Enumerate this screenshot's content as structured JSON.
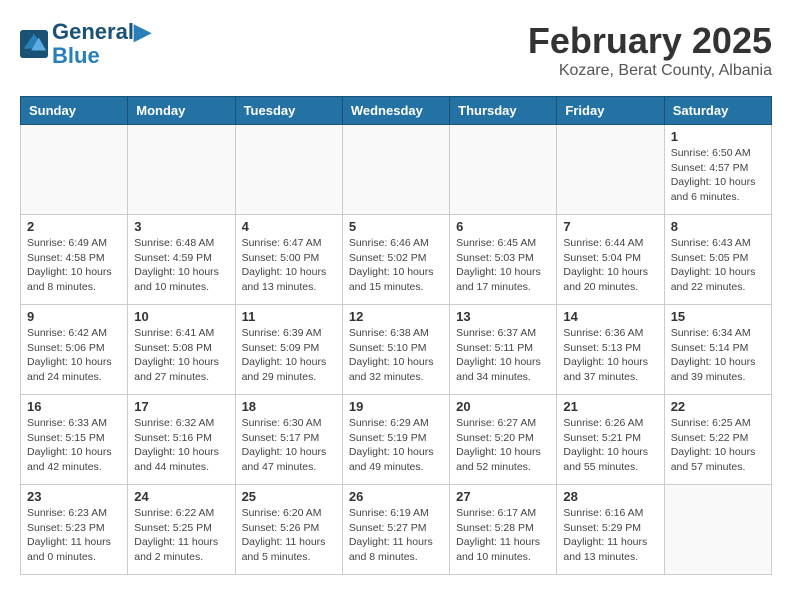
{
  "header": {
    "logo_line1": "General",
    "logo_line2": "Blue",
    "title": "February 2025",
    "subtitle": "Kozare, Berat County, Albania"
  },
  "weekdays": [
    "Sunday",
    "Monday",
    "Tuesday",
    "Wednesday",
    "Thursday",
    "Friday",
    "Saturday"
  ],
  "weeks": [
    [
      {
        "day": "",
        "info": ""
      },
      {
        "day": "",
        "info": ""
      },
      {
        "day": "",
        "info": ""
      },
      {
        "day": "",
        "info": ""
      },
      {
        "day": "",
        "info": ""
      },
      {
        "day": "",
        "info": ""
      },
      {
        "day": "1",
        "info": "Sunrise: 6:50 AM\nSunset: 4:57 PM\nDaylight: 10 hours\nand 6 minutes."
      }
    ],
    [
      {
        "day": "2",
        "info": "Sunrise: 6:49 AM\nSunset: 4:58 PM\nDaylight: 10 hours\nand 8 minutes."
      },
      {
        "day": "3",
        "info": "Sunrise: 6:48 AM\nSunset: 4:59 PM\nDaylight: 10 hours\nand 10 minutes."
      },
      {
        "day": "4",
        "info": "Sunrise: 6:47 AM\nSunset: 5:00 PM\nDaylight: 10 hours\nand 13 minutes."
      },
      {
        "day": "5",
        "info": "Sunrise: 6:46 AM\nSunset: 5:02 PM\nDaylight: 10 hours\nand 15 minutes."
      },
      {
        "day": "6",
        "info": "Sunrise: 6:45 AM\nSunset: 5:03 PM\nDaylight: 10 hours\nand 17 minutes."
      },
      {
        "day": "7",
        "info": "Sunrise: 6:44 AM\nSunset: 5:04 PM\nDaylight: 10 hours\nand 20 minutes."
      },
      {
        "day": "8",
        "info": "Sunrise: 6:43 AM\nSunset: 5:05 PM\nDaylight: 10 hours\nand 22 minutes."
      }
    ],
    [
      {
        "day": "9",
        "info": "Sunrise: 6:42 AM\nSunset: 5:06 PM\nDaylight: 10 hours\nand 24 minutes."
      },
      {
        "day": "10",
        "info": "Sunrise: 6:41 AM\nSunset: 5:08 PM\nDaylight: 10 hours\nand 27 minutes."
      },
      {
        "day": "11",
        "info": "Sunrise: 6:39 AM\nSunset: 5:09 PM\nDaylight: 10 hours\nand 29 minutes."
      },
      {
        "day": "12",
        "info": "Sunrise: 6:38 AM\nSunset: 5:10 PM\nDaylight: 10 hours\nand 32 minutes."
      },
      {
        "day": "13",
        "info": "Sunrise: 6:37 AM\nSunset: 5:11 PM\nDaylight: 10 hours\nand 34 minutes."
      },
      {
        "day": "14",
        "info": "Sunrise: 6:36 AM\nSunset: 5:13 PM\nDaylight: 10 hours\nand 37 minutes."
      },
      {
        "day": "15",
        "info": "Sunrise: 6:34 AM\nSunset: 5:14 PM\nDaylight: 10 hours\nand 39 minutes."
      }
    ],
    [
      {
        "day": "16",
        "info": "Sunrise: 6:33 AM\nSunset: 5:15 PM\nDaylight: 10 hours\nand 42 minutes."
      },
      {
        "day": "17",
        "info": "Sunrise: 6:32 AM\nSunset: 5:16 PM\nDaylight: 10 hours\nand 44 minutes."
      },
      {
        "day": "18",
        "info": "Sunrise: 6:30 AM\nSunset: 5:17 PM\nDaylight: 10 hours\nand 47 minutes."
      },
      {
        "day": "19",
        "info": "Sunrise: 6:29 AM\nSunset: 5:19 PM\nDaylight: 10 hours\nand 49 minutes."
      },
      {
        "day": "20",
        "info": "Sunrise: 6:27 AM\nSunset: 5:20 PM\nDaylight: 10 hours\nand 52 minutes."
      },
      {
        "day": "21",
        "info": "Sunrise: 6:26 AM\nSunset: 5:21 PM\nDaylight: 10 hours\nand 55 minutes."
      },
      {
        "day": "22",
        "info": "Sunrise: 6:25 AM\nSunset: 5:22 PM\nDaylight: 10 hours\nand 57 minutes."
      }
    ],
    [
      {
        "day": "23",
        "info": "Sunrise: 6:23 AM\nSunset: 5:23 PM\nDaylight: 11 hours\nand 0 minutes."
      },
      {
        "day": "24",
        "info": "Sunrise: 6:22 AM\nSunset: 5:25 PM\nDaylight: 11 hours\nand 2 minutes."
      },
      {
        "day": "25",
        "info": "Sunrise: 6:20 AM\nSunset: 5:26 PM\nDaylight: 11 hours\nand 5 minutes."
      },
      {
        "day": "26",
        "info": "Sunrise: 6:19 AM\nSunset: 5:27 PM\nDaylight: 11 hours\nand 8 minutes."
      },
      {
        "day": "27",
        "info": "Sunrise: 6:17 AM\nSunset: 5:28 PM\nDaylight: 11 hours\nand 10 minutes."
      },
      {
        "day": "28",
        "info": "Sunrise: 6:16 AM\nSunset: 5:29 PM\nDaylight: 11 hours\nand 13 minutes."
      },
      {
        "day": "",
        "info": ""
      }
    ]
  ]
}
